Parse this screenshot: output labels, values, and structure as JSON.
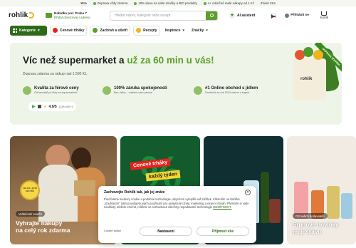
{
  "topstrip": {
    "brand": "Xtra",
    "items": [
      "Doprava vždy zdarma",
      "10% sleva na naše značky a BIO produkty",
      "4+ měsíčně malé nákupy od 1 Kč",
      "Zkusit Xtra"
    ]
  },
  "header": {
    "logo": "rohlik",
    "delivery_title": "Nabídka pro: Praha 7",
    "delivery_sub": "Přidat doručovací adresu",
    "search_placeholder": "Hledat název, kategorii nebo recept",
    "ai_label": "AI asistent",
    "login_label": "Přihlásit se",
    "cart_label": "Košík"
  },
  "nav": {
    "categories": "Kategorie",
    "items": [
      "Cenové trháky",
      "Zachraň a ušetři",
      "Recepty",
      "Inspirace",
      "Značky"
    ]
  },
  "hero": {
    "title_main": "Víc než supermarket a ",
    "title_highlight": "už za 60 min u vás!",
    "subtitle": "Doprava zdarma za nákup nad 1 500 Kč.",
    "usps": [
      {
        "title": "Kvalita za férové ceny",
        "desc": "Od farmářů po léky za supermarket!"
      },
      {
        "title": "100% záruka spokojenosti",
        "desc": "Bez rizika – vrátíme vám peníze"
      },
      {
        "title": "#1 Online obchod s jídlem",
        "desc": "Doměníš za rok 2024 máme o sapse"
      }
    ],
    "rating_value": "4.9/5",
    "rating_count": "(128 600+)",
    "ribbon": "DOPRAVA ZDARMA",
    "bag_logo": "rohlik"
  },
  "cards": [
    {
      "tag": "Velká letní soutěž",
      "title_line1": "Vyhrajte nákupy",
      "title_line2": "na celý rok zdarma",
      "badge": "VELKÁ LETNÍ SOUTĚŽ"
    },
    {
      "percent": "%",
      "label1": "Cenové trháky",
      "label2": "každý týden"
    },
    {},
    {
      "tag": "Od našich dodavatelů",
      "title_line1": "Srpnové novinky",
      "title_line2": "mají šťávu"
    }
  ],
  "cookie": {
    "title": "Zachovejte Rohlík tak, jak jej znáte",
    "body": "Používáme soubory cookie a podobné technologie, abychom vylepšili váš zážitek. Kliknutím na tlačítko „Souhlasím“ nám povolujete jejich používání pro analytické účely, marketing a externí obsah. Přestože si vaše souhlasy můžete změnit, můžete se rozhodnout všechny nepodstatné technologie ",
    "body_link": "ODMÍTNOUT.",
    "policy": "Cookie policy",
    "settings": "Nastavení",
    "accept": "Přijmout vše"
  },
  "colors": {
    "brand_green": "#5a9f2a",
    "dark_green": "#2e6a17",
    "hero_bg": "#eef5e8"
  }
}
